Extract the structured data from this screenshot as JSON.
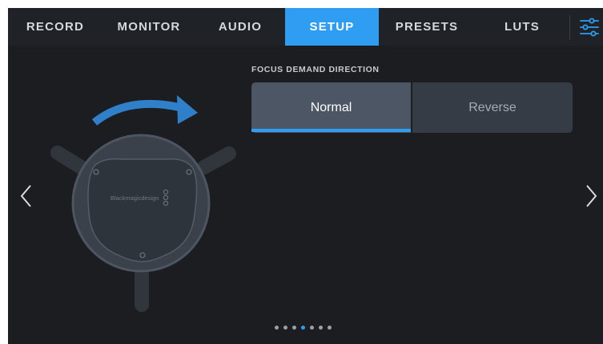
{
  "tabs": [
    {
      "label": "RECORD",
      "active": false
    },
    {
      "label": "MONITOR",
      "active": false
    },
    {
      "label": "AUDIO",
      "active": false
    },
    {
      "label": "SETUP",
      "active": true
    },
    {
      "label": "PRESETS",
      "active": false
    },
    {
      "label": "LUTS",
      "active": false
    }
  ],
  "settings_icon": "sliders-icon",
  "section": {
    "label": "FOCUS DEMAND DIRECTION",
    "options": [
      {
        "label": "Normal",
        "selected": true
      },
      {
        "label": "Reverse",
        "selected": false
      }
    ]
  },
  "illustration": {
    "device": "focus-demand-wheel",
    "logo_text": "Blackmagicdesign",
    "arrow_color": "#2f7fc9"
  },
  "pagination": {
    "total": 7,
    "current": 4
  },
  "colors": {
    "accent": "#2f9df2",
    "background": "#1b1d20",
    "tabbar": "#1f2226"
  }
}
